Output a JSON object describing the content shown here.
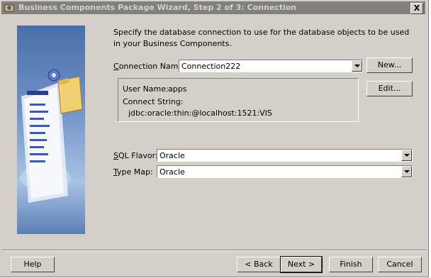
{
  "window": {
    "title": "Business Components Package Wizard, Step 2 of 3: Connection",
    "close_glyph": "X"
  },
  "instructions": "Specify the database connection to use for the database objects to be used in your Business Components.",
  "connection": {
    "label_prefix": "C",
    "label_rest": "onnection Name:",
    "value": "Connection222",
    "new_button": "New...",
    "edit_button": "Edit..."
  },
  "info": {
    "user_name_label": "User Name:",
    "user_name_value": "apps",
    "connect_string_label": "Connect String:",
    "connect_string_value": "jdbc:oracle:thin:@localhost:1521:VIS"
  },
  "sql_flavor": {
    "label_prefix": "S",
    "label_rest": "QL Flavor:",
    "value": "Oracle"
  },
  "type_map": {
    "label_prefix": "T",
    "label_rest": "ype Map:",
    "value": "Oracle"
  },
  "footer": {
    "help": "Help",
    "back": "< Back",
    "next": "Next >",
    "finish": "Finish",
    "cancel": "Cancel"
  }
}
